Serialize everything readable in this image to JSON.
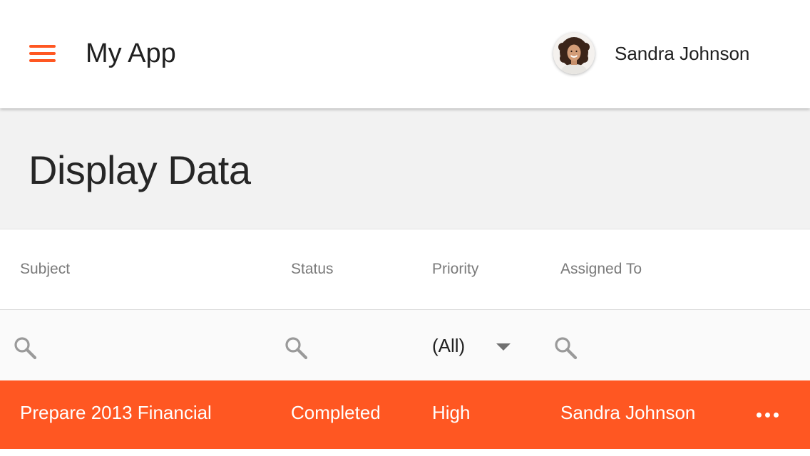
{
  "theme": {
    "accent": "#ff5722",
    "header_bg": "#ffffff",
    "band_bg": "#f2f2f2"
  },
  "header": {
    "menu_icon": "hamburger-menu-icon",
    "title": "My App",
    "user": {
      "name": "Sandra Johnson",
      "avatar_icon": "user-avatar-photo"
    }
  },
  "page": {
    "title": "Display Data"
  },
  "grid": {
    "columns": [
      {
        "label": "Subject"
      },
      {
        "label": "Status"
      },
      {
        "label": "Priority"
      },
      {
        "label": "Assigned To"
      }
    ],
    "filters": {
      "subject_icon": "search-icon",
      "status_icon": "search-icon",
      "priority_value": "(All)",
      "assigned_icon": "search-icon"
    },
    "rows": [
      {
        "subject": "Prepare 2013 Financial",
        "status": "Completed",
        "priority": "High",
        "assigned_to": "Sandra Johnson",
        "more_icon": "more-horizontal-icon",
        "selected": true
      }
    ]
  }
}
